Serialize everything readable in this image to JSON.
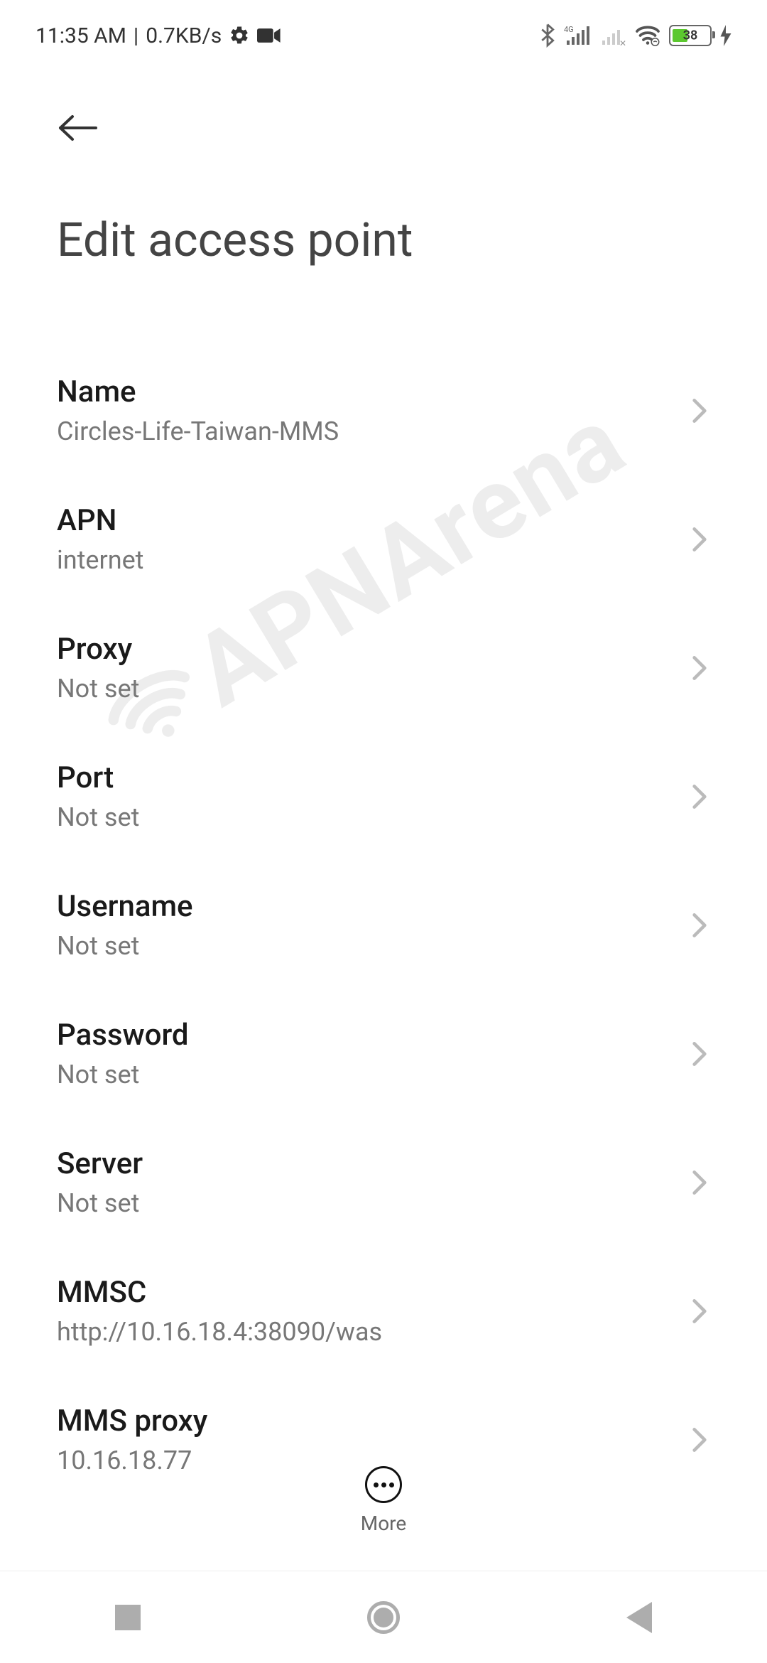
{
  "status_bar": {
    "time": "11:35 AM",
    "data_rate": "0.7KB/s",
    "battery_pct": "38"
  },
  "header": {
    "title": "Edit access point"
  },
  "settings": [
    {
      "label": "Name",
      "value": "Circles-Life-Taiwan-MMS"
    },
    {
      "label": "APN",
      "value": "internet"
    },
    {
      "label": "Proxy",
      "value": "Not set"
    },
    {
      "label": "Port",
      "value": "Not set"
    },
    {
      "label": "Username",
      "value": "Not set"
    },
    {
      "label": "Password",
      "value": "Not set"
    },
    {
      "label": "Server",
      "value": "Not set"
    },
    {
      "label": "MMSC",
      "value": "http://10.16.18.4:38090/was"
    },
    {
      "label": "MMS proxy",
      "value": "10.16.18.77"
    }
  ],
  "more": {
    "label": "More"
  },
  "watermark": "APNArena"
}
